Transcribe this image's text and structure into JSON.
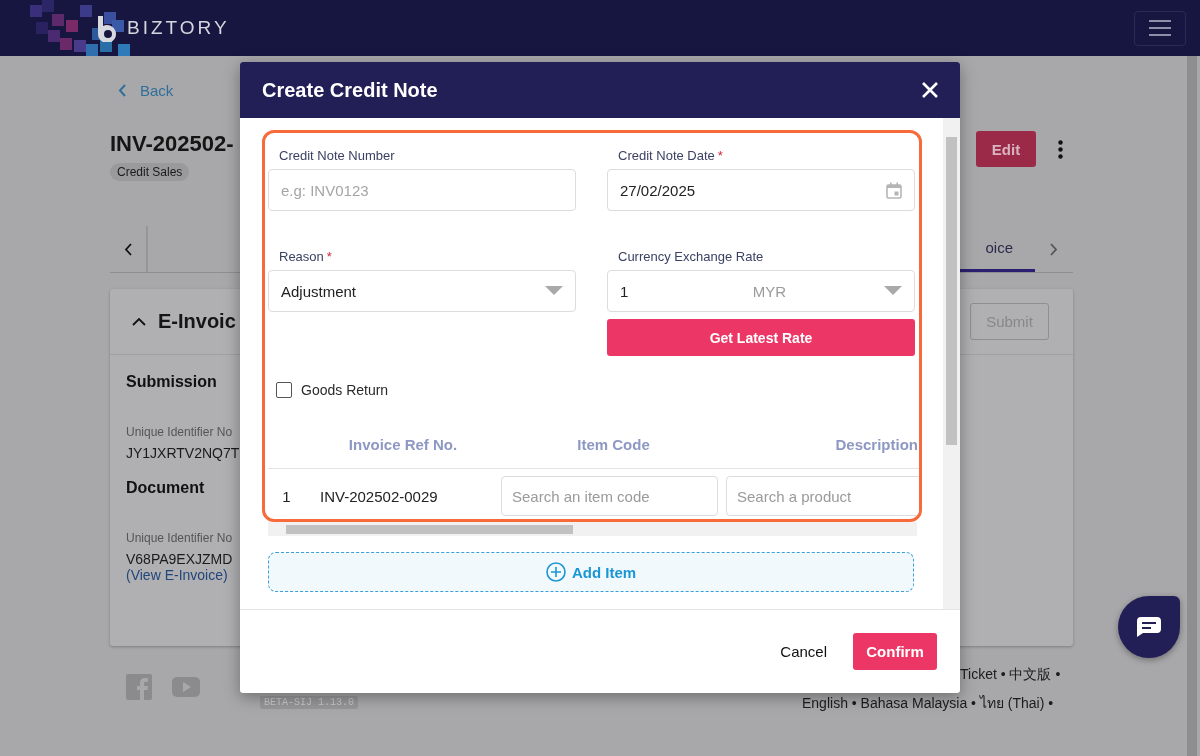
{
  "app": {
    "brand": "BIZTORY"
  },
  "page": {
    "back": "Back",
    "title": "INV-202502-",
    "badge": "Credit Sales",
    "edit": "Edit",
    "tabs": [
      {
        "label": "oice",
        "selected": true
      }
    ],
    "section": {
      "title": "E-Invoic",
      "expanded": true,
      "submit": "Submit",
      "groups": [
        {
          "heading": "Submission",
          "label": "Unique Identifier No",
          "value": "JY1JXRTV2NQ7T"
        },
        {
          "heading": "Document",
          "label": "Unique Identifier No",
          "value": "V68PA9EXJZMD",
          "link": "(View E-Invoice)"
        }
      ]
    },
    "footer": {
      "version": "BETA-SIJ 1.13.0",
      "links_line_1": "Ticket • 中文版 •",
      "links_line_2": "English • Bahasa Malaysia • ไทย (Thai) •"
    }
  },
  "dialog": {
    "title": "Create Credit Note",
    "fields": [
      {
        "kind": "text",
        "label": "Credit Note Number",
        "placeholder": "e.g: INV0123"
      },
      {
        "kind": "date",
        "label": "Credit Note Date",
        "required_mark": "*",
        "value": "27/02/2025"
      },
      {
        "kind": "select",
        "label": "Reason",
        "required_mark": "*",
        "value": "Adjustment"
      },
      {
        "kind": "rate",
        "label": "Currency Exchange Rate",
        "value": "1",
        "currency": "MYR",
        "action": "Get Latest Rate"
      }
    ],
    "goods_return": {
      "label": "Goods Return",
      "checked": false
    },
    "items_table": {
      "columns": [
        "Invoice Ref No.",
        "Item Code",
        "Description"
      ],
      "rows": [
        {
          "index": "1",
          "invoice_ref": "INV-202502-0029",
          "item_code_placeholder": "Search an item code",
          "description_placeholder": "Search a product"
        }
      ]
    },
    "add_item": "Add Item",
    "buttons": {
      "cancel": "Cancel",
      "confirm": "Confirm"
    }
  }
}
